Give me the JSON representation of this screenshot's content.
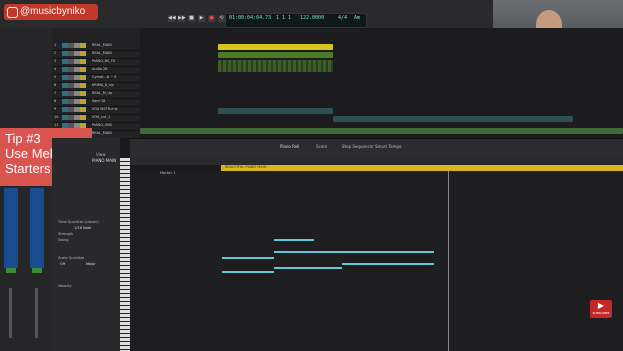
{
  "overlay": {
    "handle": "@musicbyniko",
    "tip_line1": "Tip #3",
    "tip_line2": "Use Melody",
    "tip_line3": "Starters"
  },
  "lcd": {
    "time": "01:00:04:04.73",
    "bars": "1 1 1",
    "beat": "3 1 3 82",
    "bpm": "122.0000",
    "sig": "4/4",
    "key": "Am"
  },
  "inspector": {
    "title": "PIANO MAIN",
    "time_quantize_label": "Time Quantize (classic)",
    "time_quantize_value": "1/16 Note",
    "strength_label": "Strength",
    "swing_label": "Swing",
    "scale_quantize_label": "Scale Quantize",
    "scale_off": "Off",
    "scale_major": "Major",
    "velocity_label": "Velocity"
  },
  "editor": {
    "tabs": [
      "Piano Roll",
      "Score",
      "Step Sequencer",
      "Smart Tempo"
    ],
    "view": "View",
    "region_label": "BEAUTIFUL PIANO MAIN",
    "marker": "Marker 1"
  },
  "tracks": [
    "REAL_MAIN",
    "REAL_MAIN",
    "PIANO_BS_FX",
    "Audio 28",
    "Cymat...8 ~ 9",
    "KRIMA_8_Up",
    "REAL_M_Up",
    "Sam 18",
    "VOX MSTR.mix",
    "VOX_cut_1",
    "PIANO_OBS",
    "REAL_MAIN"
  ],
  "watermark": {
    "subscribe": "SUBSCRIBE"
  }
}
